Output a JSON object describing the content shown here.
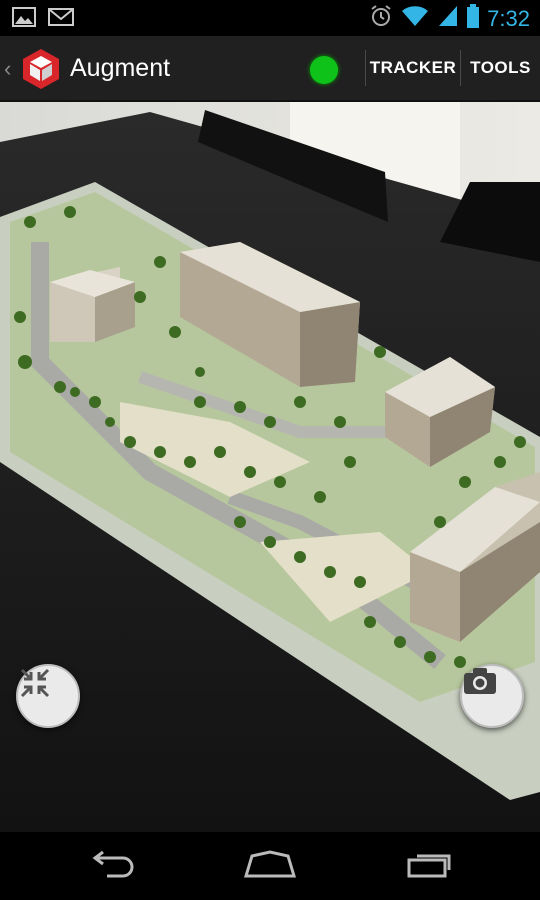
{
  "status_bar": {
    "time": "7:32",
    "icons": [
      "gallery-icon",
      "gmail-icon",
      "alarm-icon",
      "wifi-icon",
      "signal-icon",
      "battery-icon"
    ]
  },
  "action_bar": {
    "title": "Augment",
    "menu": [
      {
        "label": "TRACKER"
      },
      {
        "label": "TOOLS"
      }
    ],
    "tracking_status_color": "#0fc21a"
  },
  "camera_view": {
    "content": "augmented-reality-3d-building-model",
    "controls": {
      "left": "collapse-arrows-icon",
      "right": "camera-icon"
    }
  },
  "nav_bar": {
    "buttons": [
      "back-icon",
      "home-icon",
      "recent-apps-icon"
    ]
  },
  "colors": {
    "accent": "#33b5e5",
    "action_bar_bg": "#202020"
  }
}
